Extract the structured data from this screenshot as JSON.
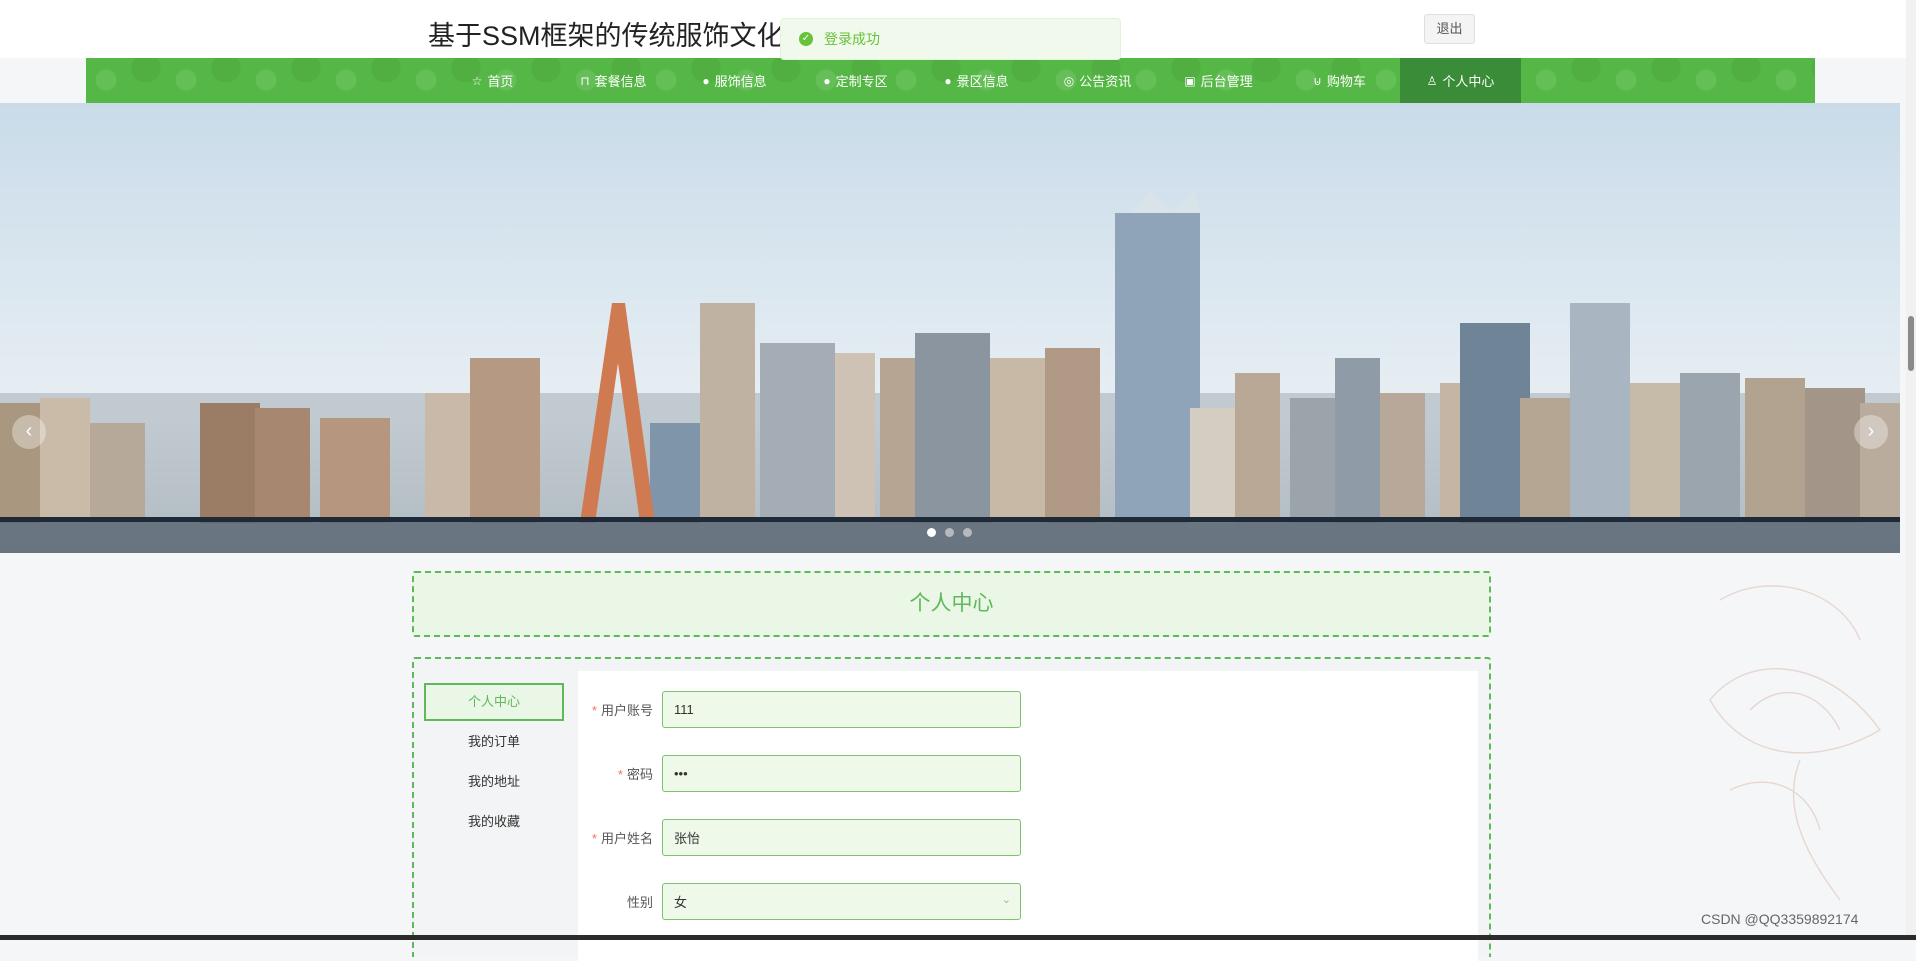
{
  "header": {
    "site_title": "基于SSM框架的传统服饰文化平",
    "logout_label": "退出"
  },
  "toast": {
    "message": "登录成功",
    "icon": "check-circle-icon",
    "color": "#67c23a"
  },
  "nav": {
    "background": "#55b745",
    "active_background": "#3a8c39",
    "items": [
      {
        "label": "首页",
        "icon": "star-icon"
      },
      {
        "label": "套餐信息",
        "icon": "bag-icon"
      },
      {
        "label": "服饰信息",
        "icon": "info-icon"
      },
      {
        "label": "定制专区",
        "icon": "question-icon"
      },
      {
        "label": "景区信息",
        "icon": "info-icon"
      },
      {
        "label": "公告资讯",
        "icon": "at-icon"
      },
      {
        "label": "后台管理",
        "icon": "box-icon"
      },
      {
        "label": "购物车",
        "icon": "cart-icon"
      },
      {
        "label": "个人中心",
        "icon": "user-icon",
        "active": true
      }
    ]
  },
  "carousel": {
    "slide_count": 3,
    "active_index": 0,
    "prev_icon": "chevron-left-icon",
    "next_icon": "chevron-right-icon"
  },
  "page_title": "个人中心",
  "side_menu": [
    {
      "label": "个人中心",
      "active": true
    },
    {
      "label": "我的订单"
    },
    {
      "label": "我的地址"
    },
    {
      "label": "我的收藏"
    }
  ],
  "form": {
    "account": {
      "label": "用户账号",
      "value": "111",
      "required": true
    },
    "password": {
      "label": "密码",
      "value": "•••",
      "required": true
    },
    "name": {
      "label": "用户姓名",
      "value": "张怡",
      "required": true
    },
    "gender": {
      "label": "性别",
      "value": "女",
      "required": false
    }
  },
  "watermark": "CSDN @QQ3359892174",
  "accent_color": "#5fb85a"
}
